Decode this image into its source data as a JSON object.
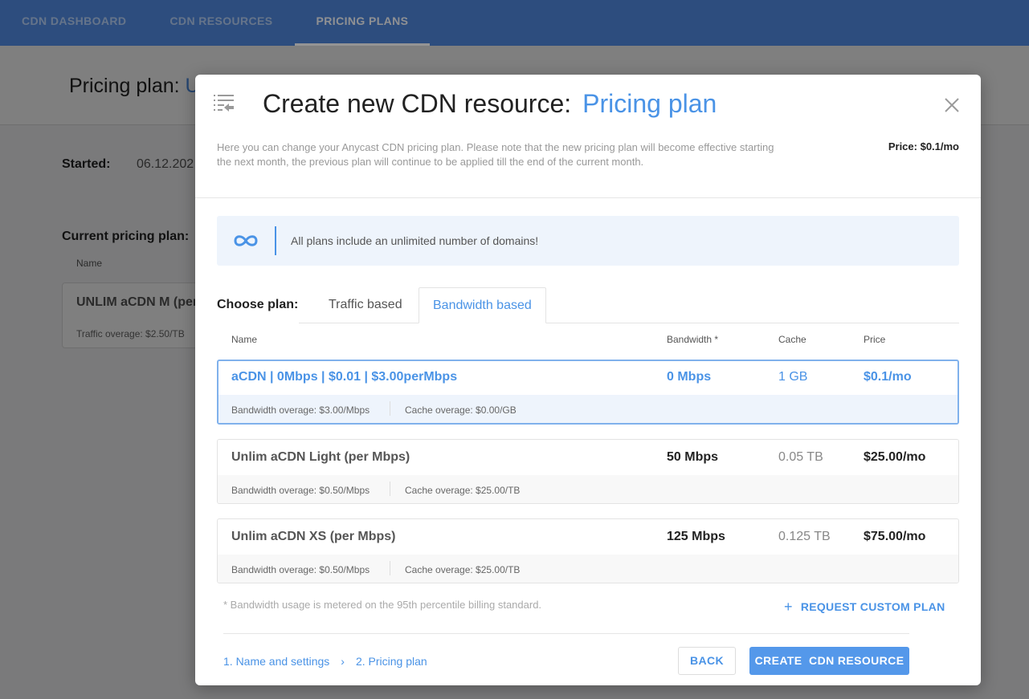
{
  "topnav": {
    "items": [
      {
        "label": "CDN DASHBOARD",
        "active": false
      },
      {
        "label": "CDN RESOURCES",
        "active": false
      },
      {
        "label": "PRICING PLANS",
        "active": true
      }
    ]
  },
  "background": {
    "title_prefix": "Pricing plan:",
    "title_value": "U",
    "started_label": "Started:",
    "started_value": "06.12.202",
    "current_plan_label": "Current pricing plan:",
    "col_name": "Name",
    "current_plan": {
      "name": "UNLIM aCDN M (per",
      "traffic_overage": "Traffic overage: $2.50/TB"
    }
  },
  "modal": {
    "icon": "playlist-back-icon",
    "title": "Create new CDN resource:",
    "title_accent": "Pricing plan",
    "close_icon": "close-icon",
    "description": "Here you can change your Anycast CDN pricing plan. Please note that the new pricing plan will become effective starting the next month, the previous plan will continue to be applied till the end of the current month.",
    "price": "Price: $0.1/mo",
    "info": {
      "icon": "infinity-icon",
      "text": "All plans include an unlimited number of domains!"
    },
    "choose_label": "Choose plan:",
    "tabs": [
      {
        "label": "Traffic based",
        "active": false
      },
      {
        "label": "Bandwidth based",
        "active": true
      }
    ],
    "table": {
      "headers": {
        "name": "Name",
        "bandwidth": "Bandwidth *",
        "cache": "Cache",
        "price": "Price"
      },
      "plans": [
        {
          "name": "aCDN | 0Mbps | $0.01 | $3.00perMbps",
          "bandwidth": "0 Mbps",
          "cache": "1 GB",
          "price": "$0.1/mo",
          "bandwidth_overage": "Bandwidth overage: $3.00/Mbps",
          "cache_overage": "Cache overage: $0.00/GB",
          "selected": true
        },
        {
          "name": "Unlim aCDN Light (per Mbps)",
          "bandwidth": "50 Mbps",
          "cache": "0.05 TB",
          "price": "$25.00/mo",
          "bandwidth_overage": "Bandwidth overage: $0.50/Mbps",
          "cache_overage": "Cache overage: $25.00/TB",
          "selected": false
        },
        {
          "name": "Unlim aCDN XS (per Mbps)",
          "bandwidth": "125 Mbps",
          "cache": "0.125 TB",
          "price": "$75.00/mo",
          "bandwidth_overage": "Bandwidth overage: $0.50/Mbps",
          "cache_overage": "Cache overage: $25.00/TB",
          "selected": false
        }
      ]
    },
    "footnote": "* Bandwidth usage is metered on the 95th percentile billing standard.",
    "request_custom": {
      "icon": "plus-icon",
      "label": "REQUEST CUSTOM PLAN"
    },
    "steps": [
      {
        "label": "1. Name and settings"
      },
      {
        "label": "2. Pricing plan"
      }
    ],
    "back_label": "BACK",
    "create_label": "CREATE  CDN RESOURCE"
  },
  "colors": {
    "nav_bg": "#4f86d9",
    "accent": "#4a93e6",
    "selected_border": "#80b1ec",
    "info_bg": "#eef4fc",
    "primary_button": "#5498ea"
  }
}
